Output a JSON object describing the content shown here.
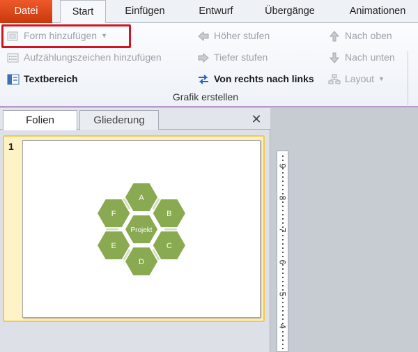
{
  "tabs": {
    "file": "Datei",
    "start": "Start",
    "insert": "Einfügen",
    "design": "Entwurf",
    "transitions": "Übergänge",
    "animations": "Animationen"
  },
  "ribbon": {
    "add_shape": "Form hinzufügen",
    "add_bullet": "Aufzählungszeichen hinzufügen",
    "text_pane": "Textbereich",
    "promote": "Höher stufen",
    "demote": "Tiefer stufen",
    "right_to_left": "Von rechts nach links",
    "move_up": "Nach oben",
    "move_down": "Nach unten",
    "layout": "Layout",
    "group_label": "Grafik erstellen"
  },
  "panel": {
    "tab_slides": "Folien",
    "tab_outline": "Gliederung",
    "close": "✕",
    "slide_number": "1"
  },
  "smartart": {
    "center": "Projekt",
    "A": "A",
    "B": "B",
    "C": "C",
    "D": "D",
    "E": "E",
    "F": "F",
    "fill_color": "#8aaa52",
    "connector_color": "#d3dfc0"
  },
  "ruler": {
    "numbers": [
      "9",
      "8",
      "7",
      "6",
      "5",
      "4"
    ]
  },
  "colors": {
    "file_tab": "#d83b01",
    "highlight_border": "#d1141f",
    "selected_thumb_border": "#f2c84a"
  }
}
